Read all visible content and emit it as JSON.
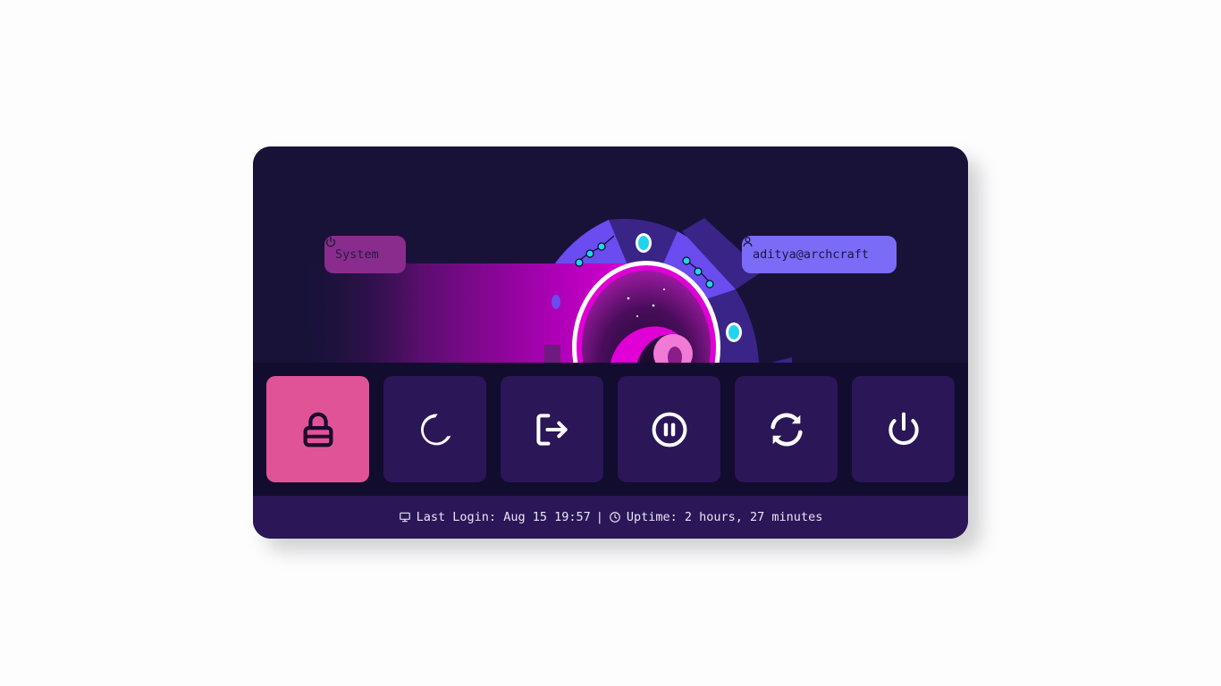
{
  "header": {
    "mode_label": "System",
    "user_label": "aditya@archcraft",
    "mode_icon": "power-icon",
    "user_icon": "user-icon"
  },
  "actions": [
    {
      "id": "lock",
      "icon": "lock-icon",
      "active": true
    },
    {
      "id": "suspend",
      "icon": "moon-icon",
      "active": false
    },
    {
      "id": "logout",
      "icon": "logout-icon",
      "active": false
    },
    {
      "id": "hibernate",
      "icon": "pause-circle-icon",
      "active": false
    },
    {
      "id": "reboot",
      "icon": "refresh-icon",
      "active": false
    },
    {
      "id": "shutdown",
      "icon": "power-icon",
      "active": false
    }
  ],
  "status": {
    "last_login_label": "Last Login: Aug 15 19:57",
    "separator": "|",
    "uptime_label": "Uptime: 2 hours, 27 minutes"
  },
  "colors": {
    "window_bg": "#181239",
    "button_bg": "#2b1658",
    "button_active_bg": "#e15397",
    "system_pill": "#8a2c8e",
    "user_pill": "#7b6cf7",
    "status_bar": "#2b1658"
  }
}
